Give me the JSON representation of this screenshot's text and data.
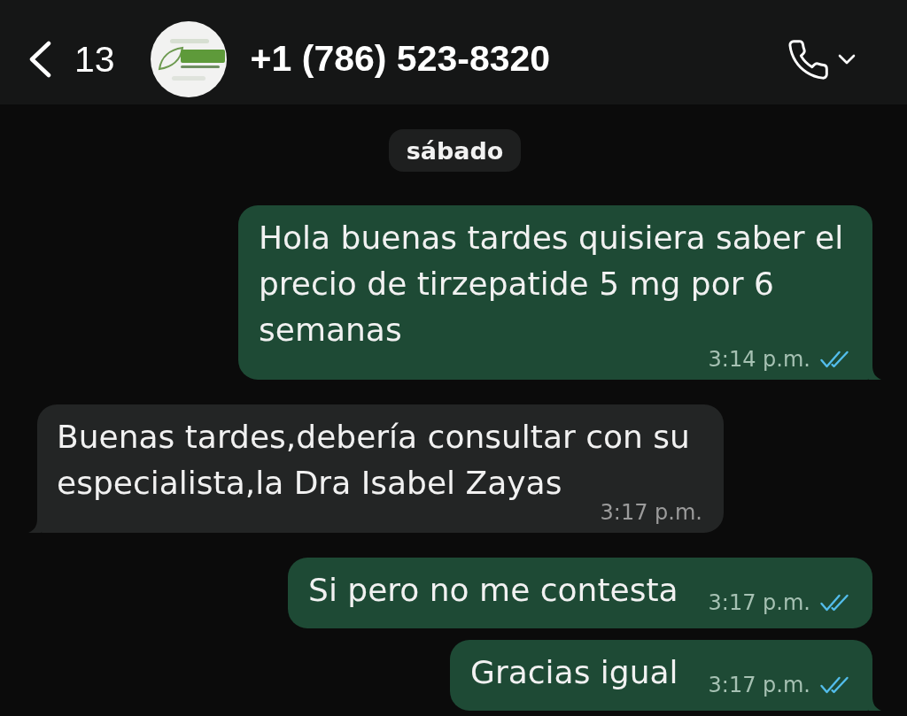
{
  "header": {
    "back_count": "13",
    "contact": "+1 (786) 523-8320"
  },
  "date_chip": "sábado",
  "messages": [
    {
      "kind": "outgoing",
      "text": "Hola buenas tardes quisiera saber el precio de tirzepatide 5 mg por 6 semanas",
      "time": "3:14 p.m.",
      "read": true,
      "tail": true
    },
    {
      "kind": "incoming",
      "text": "Buenas tardes,debería consultar con su especialista,la Dra Isabel Zayas",
      "time": "3:17 p.m.",
      "tail": true
    },
    {
      "kind": "outgoing",
      "text": "Si pero no me contesta",
      "time": "3:17 p.m.",
      "read": true,
      "tail": false
    },
    {
      "kind": "outgoing",
      "text": "Gracias igual",
      "time": "3:17 p.m.",
      "read": true,
      "tail": true
    }
  ]
}
